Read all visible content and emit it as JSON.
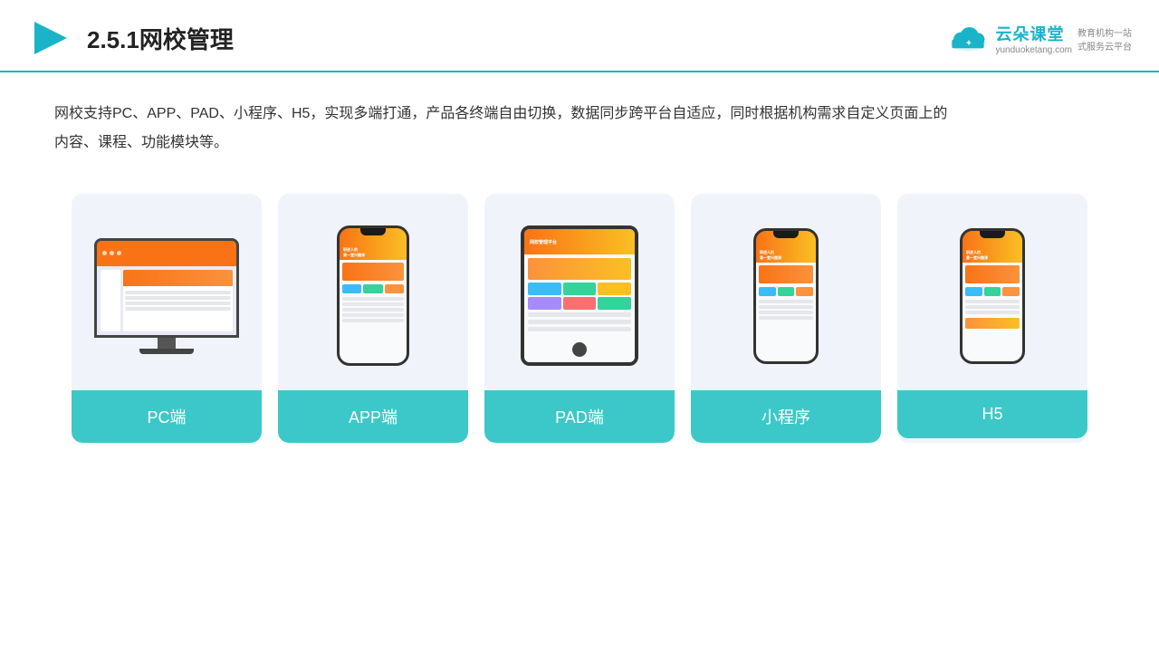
{
  "header": {
    "title": "2.5.1网校管理",
    "brand_name": "云朵课堂",
    "brand_url": "yunduoketang.com",
    "brand_sub": "教育机构一站\n式服务云平台"
  },
  "description": {
    "text": "网校支持PC、APP、PAD、小程序、H5，实现多端打通，产品各终端自由切换，数据同步跨平台自适应，同时根据机构需求自定义页面上的内容、课程、功能模块等。"
  },
  "cards": [
    {
      "label": "PC端",
      "type": "pc"
    },
    {
      "label": "APP端",
      "type": "phone"
    },
    {
      "label": "PAD端",
      "type": "tablet"
    },
    {
      "label": "小程序",
      "type": "phone2"
    },
    {
      "label": "H5",
      "type": "phone3"
    }
  ],
  "accent_color": "#3cc8c8",
  "border_color": "#1ab3c8"
}
